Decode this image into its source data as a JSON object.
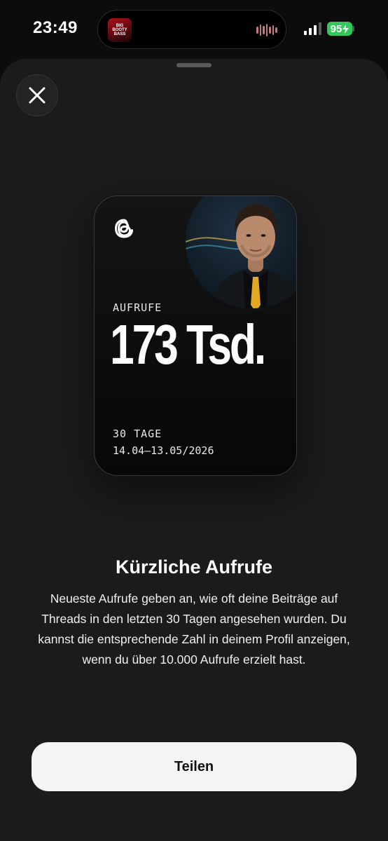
{
  "status_bar": {
    "time": "23:49",
    "battery": "95",
    "album_art_text": [
      "BIG",
      "BOOTY",
      "BASS"
    ]
  },
  "card": {
    "views_label": "AUFRUFE",
    "views_value": "173 Tsd.",
    "period_label": "30 TAGE",
    "period_range": "14.04–13.05/2026"
  },
  "info": {
    "heading": "Kürzliche Aufrufe",
    "description": "Neueste Aufrufe geben an, wie oft deine Beiträge auf Threads in den letzten 30 Tagen angesehen wurden. Du kannst die entsprechende Zahl in deinem Profil anzeigen, wenn du über 10.000 Aufrufe erzielt hast."
  },
  "actions": {
    "share_label": "Teilen"
  },
  "colors": {
    "background": "#1b1b1b",
    "battery": "#34c759",
    "button_bg": "#f4f4f4"
  },
  "icons": {
    "close": "close-icon",
    "threads": "threads-logo-icon",
    "signal": "cellular-signal-icon"
  }
}
